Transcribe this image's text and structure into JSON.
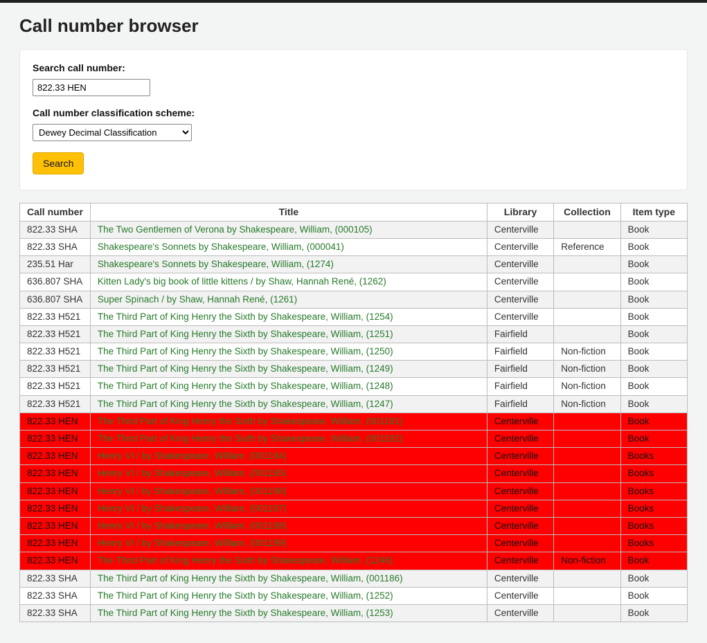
{
  "page": {
    "title": "Call number browser"
  },
  "form": {
    "search_label": "Search call number:",
    "search_value": "822.33 HEN",
    "scheme_label": "Call number classification scheme:",
    "scheme_value": "Dewey Decimal Classification",
    "search_button": "Search"
  },
  "columns": {
    "call": "Call number",
    "title": "Title",
    "library": "Library",
    "collection": "Collection",
    "itemtype": "Item type"
  },
  "rows": [
    {
      "call": "822.33 SHA",
      "title": "The Two Gentlemen of Verona by Shakespeare, William, (000105)",
      "library": "Centerville",
      "collection": "",
      "itemtype": "Book",
      "hl": false
    },
    {
      "call": "822.33 SHA",
      "title": "Shakespeare's Sonnets by Shakespeare, William, (000041)",
      "library": "Centerville",
      "collection": "Reference",
      "itemtype": "Book",
      "hl": false
    },
    {
      "call": "235.51 Har",
      "title": "Shakespeare's Sonnets by Shakespeare, William, (1274)",
      "library": "Centerville",
      "collection": "",
      "itemtype": "Book",
      "hl": false
    },
    {
      "call": "636.807 SHA",
      "title": "Kitten Lady's big book of little kittens / by Shaw, Hannah René, (1262)",
      "library": "Centerville",
      "collection": "",
      "itemtype": "Book",
      "hl": false
    },
    {
      "call": "636.807 SHA",
      "title": "Super Spinach / by Shaw, Hannah René, (1261)",
      "library": "Centerville",
      "collection": "",
      "itemtype": "Book",
      "hl": false
    },
    {
      "call": "822.33 H521",
      "title": "The Third Part of King Henry the Sixth by Shakespeare, William, (1254)",
      "library": "Centerville",
      "collection": "",
      "itemtype": "Book",
      "hl": false
    },
    {
      "call": "822.33 H521",
      "title": "The Third Part of King Henry the Sixth by Shakespeare, William, (1251)",
      "library": "Fairfield",
      "collection": "",
      "itemtype": "Book",
      "hl": false
    },
    {
      "call": "822.33 H521",
      "title": "The Third Part of King Henry the Sixth by Shakespeare, William, (1250)",
      "library": "Fairfield",
      "collection": "Non-fiction",
      "itemtype": "Book",
      "hl": false
    },
    {
      "call": "822.33 H521",
      "title": "The Third Part of King Henry the Sixth by Shakespeare, William, (1249)",
      "library": "Fairfield",
      "collection": "Non-fiction",
      "itemtype": "Book",
      "hl": false
    },
    {
      "call": "822.33 H521",
      "title": "The Third Part of King Henry the Sixth by Shakespeare, William, (1248)",
      "library": "Fairfield",
      "collection": "Non-fiction",
      "itemtype": "Book",
      "hl": false
    },
    {
      "call": "822.33 H521",
      "title": "The Third Part of King Henry the Sixth by Shakespeare, William, (1247)",
      "library": "Fairfield",
      "collection": "Non-fiction",
      "itemtype": "Book",
      "hl": false
    },
    {
      "call": "822.33 HEN",
      "title": "The Third Part of King Henry the Sixth by Shakespeare, William, (001191)",
      "library": "Centerville",
      "collection": "",
      "itemtype": "Book",
      "hl": true
    },
    {
      "call": "822.33 HEN",
      "title": "The Third Part of King Henry the Sixth by Shakespeare, William, (001192)",
      "library": "Centerville",
      "collection": "",
      "itemtype": "Book",
      "hl": true
    },
    {
      "call": "822.33 HEN",
      "title": "Henry VI / by Shakespeare, William, (001194)",
      "library": "Centerville",
      "collection": "",
      "itemtype": "Books",
      "hl": true
    },
    {
      "call": "822.33 HEN",
      "title": "Henry VI / by Shakespeare, William, (001195)",
      "library": "Centerville",
      "collection": "",
      "itemtype": "Books",
      "hl": true
    },
    {
      "call": "822.33 HEN",
      "title": "Henry VI / by Shakespeare, William, (001196)",
      "library": "Centerville",
      "collection": "",
      "itemtype": "Books",
      "hl": true
    },
    {
      "call": "822.33 HEN",
      "title": "Henry VI / by Shakespeare, William, (001197)",
      "library": "Centerville",
      "collection": "",
      "itemtype": "Books",
      "hl": true
    },
    {
      "call": "822.33 HEN",
      "title": "Henry VI / by Shakespeare, William, (001198)",
      "library": "Centerville",
      "collection": "",
      "itemtype": "Books",
      "hl": true
    },
    {
      "call": "822.33 HEN",
      "title": "Henry VI / by Shakespeare, William, (001199)",
      "library": "Centerville",
      "collection": "",
      "itemtype": "Books",
      "hl": true
    },
    {
      "call": "822.33 HEN",
      "title": "The Third Part of King Henry the Sixth by Shakespeare, William, (1246)",
      "library": "Centerville",
      "collection": "Non-fiction",
      "itemtype": "Book",
      "hl": true
    },
    {
      "call": "822.33 SHA",
      "title": "The Third Part of King Henry the Sixth by Shakespeare, William, (001186)",
      "library": "Centerville",
      "collection": "",
      "itemtype": "Book",
      "hl": false
    },
    {
      "call": "822.33 SHA",
      "title": "The Third Part of King Henry the Sixth by Shakespeare, William, (1252)",
      "library": "Centerville",
      "collection": "",
      "itemtype": "Book",
      "hl": false
    },
    {
      "call": "822.33 SHA",
      "title": "The Third Part of King Henry the Sixth by Shakespeare, William, (1253)",
      "library": "Centerville",
      "collection": "",
      "itemtype": "Book",
      "hl": false
    }
  ]
}
